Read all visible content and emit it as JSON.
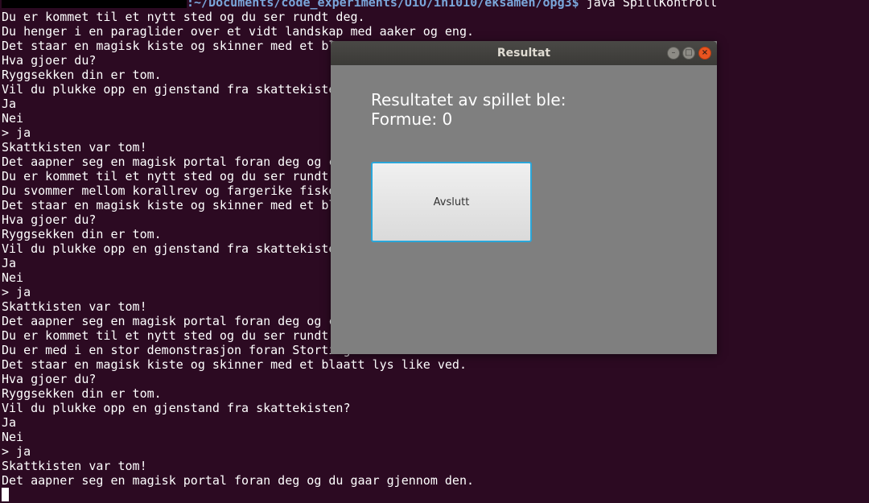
{
  "terminal": {
    "prompt_path": ":~/Documents/code_experiments/UiO/in1010/eksamen/opg3$",
    "prompt_command": " java SpillKontroll",
    "lines": [
      "Du er kommet til et nytt sted og du ser rundt deg.",
      "Du henger i en paraglider over et vidt landskap med aaker og eng.",
      "Det staar en magisk kiste og skinner med et bl",
      "Hva gjoer du?",
      "Ryggsekken din er tom.",
      "Vil du plukke opp en gjenstand fra skattekiste",
      "Ja",
      "Nei",
      "> ja",
      "Skattkisten var tom!",
      "Det aapner seg en magisk portal foran deg og c",
      "Du er kommet til et nytt sted og du ser rundt",
      "Du svommer mellom korallrev og fargerike fiske",
      "Det staar en magisk kiste og skinner med et bl",
      "Hva gjoer du?",
      "Ryggsekken din er tom.",
      "Vil du plukke opp en gjenstand fra skattekiste",
      "Ja",
      "Nei",
      "> ja",
      "Skattkisten var tom!",
      "Det aapner seg en magisk portal foran deg og c",
      "Du er kommet til et nytt sted og du ser rundt",
      "Du er med i en stor demonstrasjon foran Stortinget.",
      "Det staar en magisk kiste og skinner med et blaatt lys like ved.",
      "Hva gjoer du?",
      "Ryggsekken din er tom.",
      "Vil du plukke opp en gjenstand fra skattekisten?",
      "Ja",
      "Nei",
      "> ja",
      "Skattkisten var tom!",
      "Det aapner seg en magisk portal foran deg og du gaar gjennom den."
    ]
  },
  "dialog": {
    "title": "Resultat",
    "result_line1": "Resultatet av spillet ble:",
    "result_line2": "Formue: 0",
    "button_label": "Avslutt",
    "minimize_glyph": "–",
    "maximize_glyph": "□",
    "close_glyph": "×"
  },
  "colors": {
    "terminal_bg": "#2c0a22",
    "dialog_bg": "#7f7f7f",
    "close_button": "#e95420",
    "focus_ring": "#2aa6d9"
  }
}
